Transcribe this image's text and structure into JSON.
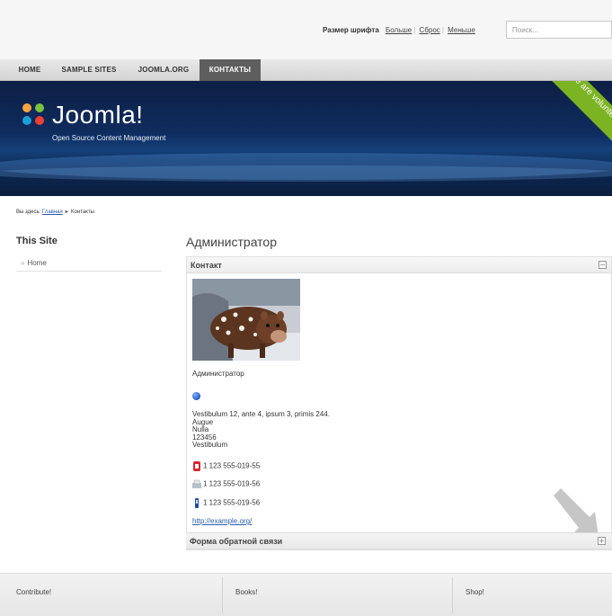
{
  "top": {
    "font_size_label": "Размер шрифта",
    "bigger": "Больше",
    "reset": "Сброс",
    "smaller": "Меньше",
    "search_placeholder": "Поиск..."
  },
  "menu": {
    "items": [
      "HOME",
      "SAMPLE SITES",
      "JOOMLA.ORG",
      "КОНТАКТЫ"
    ],
    "active_index": 3
  },
  "banner": {
    "logo": "Joomla!",
    "tagline": "Open Source Content Management",
    "ribbon": "We are volunteers!"
  },
  "breadcrumb": {
    "prefix": "Вы здесь:",
    "home": "Главная",
    "separator": "►",
    "current": "Контакты"
  },
  "sidebar": {
    "title": "This Site",
    "items": [
      "Home"
    ]
  },
  "main": {
    "title": "Администратор",
    "contact_panel": "Контакт",
    "contact_name": "Администратор",
    "address": [
      "Vestibulum 12, ante 4, ipsum 3, primis 244.",
      "Augue",
      "Nulla",
      "123456",
      "Vestibulum"
    ],
    "telephone": "1 123 555-019-55",
    "fax": "1 123 555-019-56",
    "mobile": "1 123 555-019-56",
    "webpage": "http://example.org/",
    "form_panel": "Форма обратной связи",
    "collapse_symbol": "−",
    "expand_symbol": "+"
  },
  "footer": {
    "columns": [
      "Contribute!",
      "Books!",
      "Shop!"
    ]
  },
  "colors": {
    "banner": "#0f2c5e",
    "ribbon": "#7cb322",
    "link": "#2a5db0",
    "menu_active": "#5e5e5e"
  }
}
